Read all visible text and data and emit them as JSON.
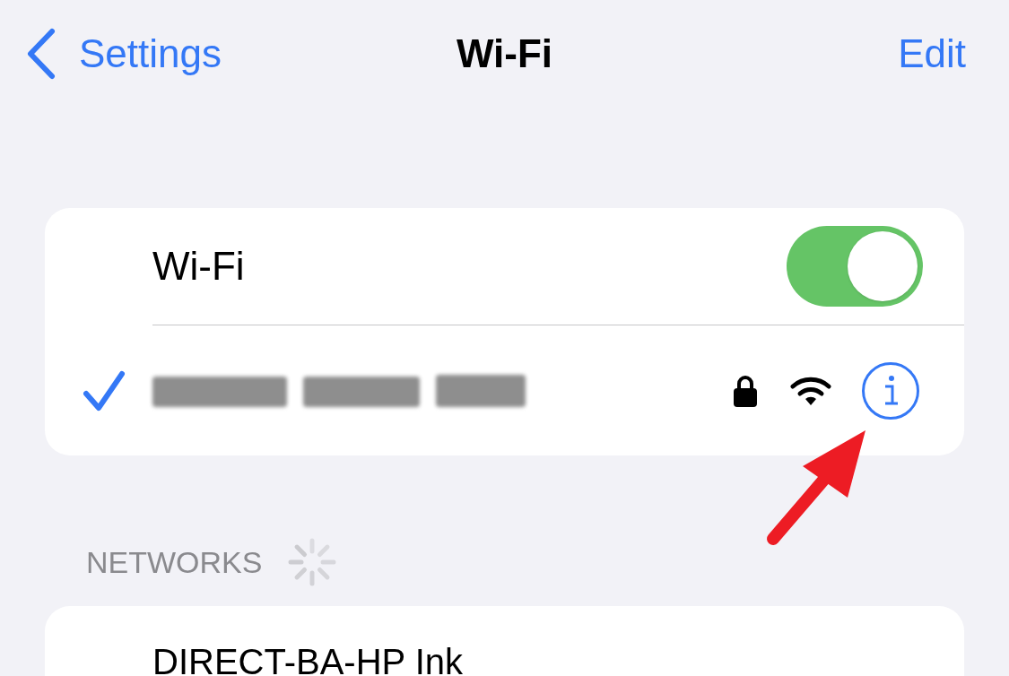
{
  "nav": {
    "back_label": "Settings",
    "title": "Wi-Fi",
    "action": "Edit"
  },
  "wifi": {
    "label": "Wi-Fi",
    "on": true
  },
  "current_network": {
    "selected": true,
    "locked": true
  },
  "networks_header": "NETWORKS",
  "networks": [
    {
      "name": "DIRECT-BA-HP Ink"
    }
  ]
}
